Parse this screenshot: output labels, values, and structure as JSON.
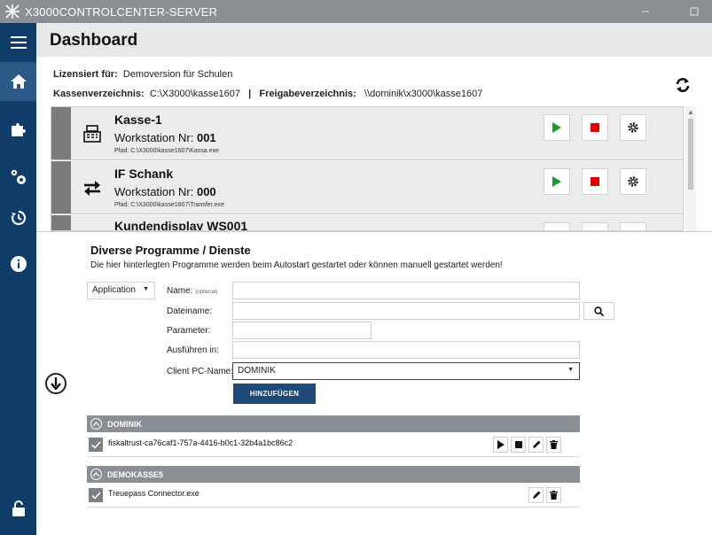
{
  "window": {
    "title": "X3000CONTROLCENTER-SERVER"
  },
  "header": {
    "title": "Dashboard"
  },
  "license": {
    "label": "Lizensiert für:",
    "value": "Demoversion für Schulen"
  },
  "dirs": {
    "kassen_label": "Kassenverzeichnis:",
    "kassen_value": "C:\\X3000\\kasse1607",
    "separator": "|",
    "freigabe_label": "Freigabeverzeichnis:",
    "freigabe_value": "\\\\dominik\\x3000\\kasse1607"
  },
  "workstations": [
    {
      "name": "Kasse-1",
      "ws_label": "Workstation Nr:",
      "ws_nr": "001",
      "path": "Pfad: C:\\X3000\\kasse1607\\Kassa.exe",
      "icon": "cash-register-icon"
    },
    {
      "name": "IF Schank",
      "ws_label": "Workstation Nr:",
      "ws_nr": "000",
      "path": "Pfad: C:\\X3000\\kasse1607\\Transfer.exe",
      "icon": "transfer-arrows-icon"
    },
    {
      "name": "Kundendisplay WS001",
      "ws_label": "",
      "ws_nr": "",
      "path": "",
      "icon": ""
    }
  ],
  "programs": {
    "title": "Diverse Programme / Dienste",
    "subtitle": "Die hier hinterlegten Programme werden beim Autostart gestartet oder können manuell gestartet werden!",
    "type_select": "Application",
    "name_label": "Name:",
    "name_optional": "(optional)",
    "dateiname_label": "Dateiname:",
    "parameter_label": "Parameter:",
    "ausfuehren_label": "Ausführen in:",
    "client_label": "Client PC-Name:",
    "client_value": "DOMINIK",
    "add_button": "HINZUFÜGEN"
  },
  "groups": [
    {
      "name": "DOMINIK",
      "entries": [
        {
          "name": "fiskaltrust-ca76caf1-757a-4416-b0c1-32b4a1bc86c2"
        }
      ]
    },
    {
      "name": "DEMOKASSE5",
      "entries": [
        {
          "name": "Treuepass Connector.exe"
        }
      ]
    }
  ],
  "colors": {
    "sidebar": "#0f3c69",
    "titlebar": "#8a8f93",
    "play": "#1a9a2a",
    "stop": "#e00000",
    "button": "#1d4a77"
  }
}
